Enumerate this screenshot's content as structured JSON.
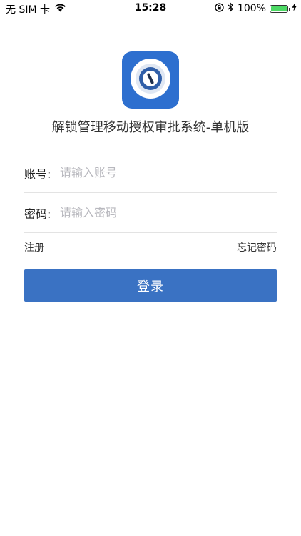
{
  "status_bar": {
    "carrier": "无 SIM 卡",
    "time": "15:28",
    "battery_percent": "100%",
    "battery_level": 1.0,
    "icons": [
      "wifi-icon",
      "rotation-lock-icon",
      "bluetooth-icon",
      "battery-icon",
      "charging-icon"
    ]
  },
  "app": {
    "icon": "lock-dial-icon",
    "title": "解锁管理移动授权审批系统-单机版",
    "brand_color": "#2d6fcf"
  },
  "form": {
    "account_label": "账号:",
    "account_placeholder": "请输入账号",
    "account_value": "",
    "password_label": "密码:",
    "password_placeholder": "请输入密码",
    "password_value": ""
  },
  "links": {
    "register": "注册",
    "forgot_password": "忘记密码"
  },
  "login_button": {
    "label": "登录",
    "color": "#3a72c3"
  }
}
